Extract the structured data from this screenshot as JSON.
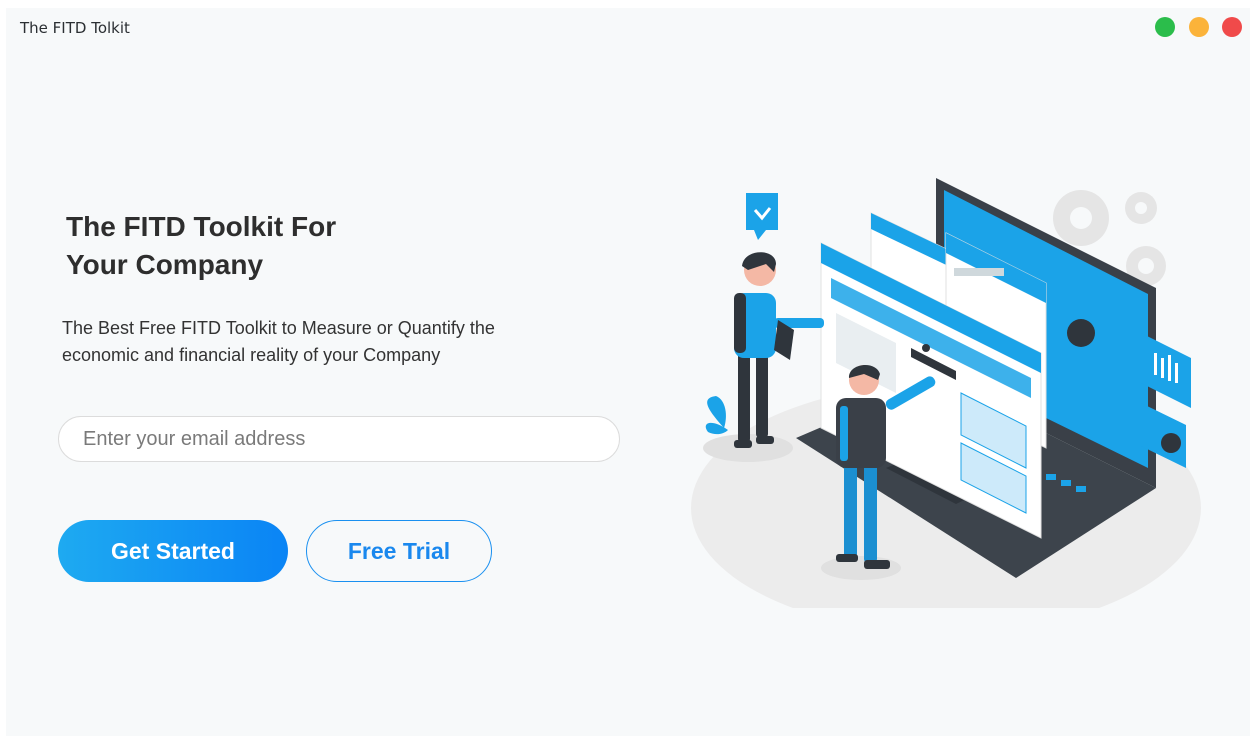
{
  "window": {
    "title": "The FITD Tolkit",
    "controls": [
      {
        "name": "maximize",
        "color": "#2bbd4b"
      },
      {
        "name": "minimize",
        "color": "#fbb33a"
      },
      {
        "name": "close",
        "color": "#f04a4a"
      }
    ]
  },
  "hero": {
    "title_line1": "The FITD Toolkit For",
    "title_line2": "Your Company",
    "subtitle_line1": "The Best Free FITD Toolkit to Measure or Quantify the",
    "subtitle_line2": "economic and financial reality of your Company"
  },
  "email": {
    "placeholder": "Enter your email address",
    "value": ""
  },
  "buttons": {
    "get_started": "Get Started",
    "free_trial": "Free Trial"
  },
  "colors": {
    "accent": "#1a90f0",
    "illustration_blue": "#1ba3e8"
  }
}
